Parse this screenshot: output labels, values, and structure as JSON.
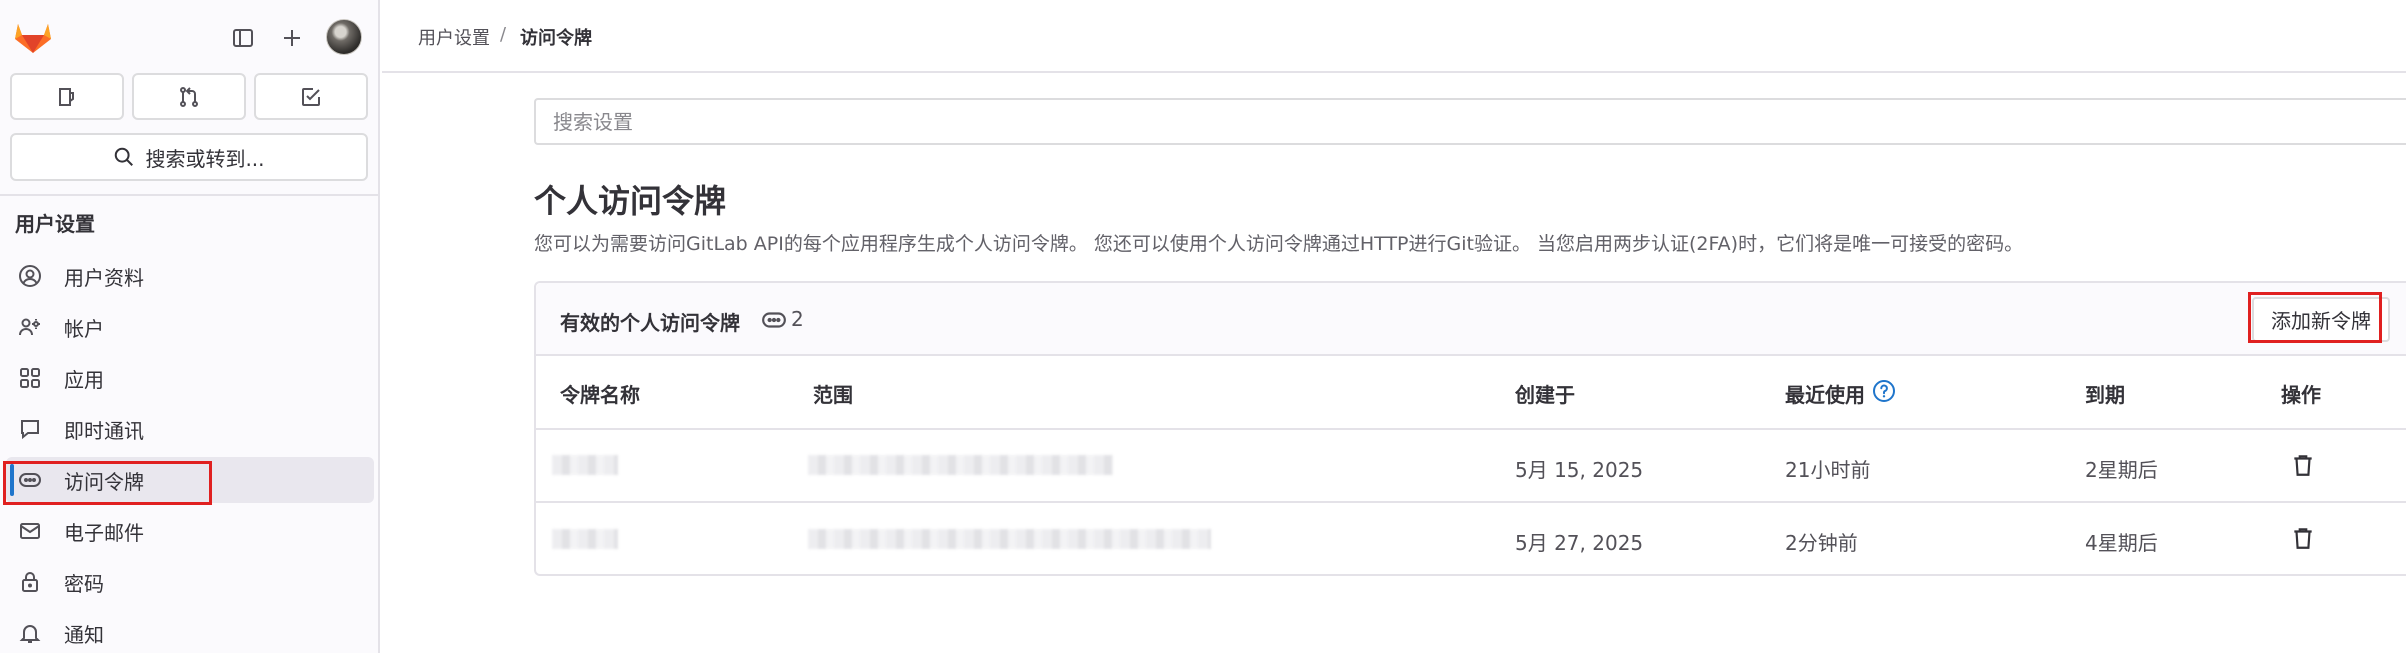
{
  "sidebar": {
    "quick_actions": [
      "issues",
      "merge-requests",
      "todos"
    ],
    "search_label": "搜索或转到...",
    "section_title": "用户设置",
    "items": [
      {
        "label": "用户资料",
        "icon": "profile-icon"
      },
      {
        "label": "帐户",
        "icon": "account-icon"
      },
      {
        "label": "应用",
        "icon": "applications-icon"
      },
      {
        "label": "即时通讯",
        "icon": "chat-icon"
      },
      {
        "label": "访问令牌",
        "icon": "token-icon",
        "active": true
      },
      {
        "label": "电子邮件",
        "icon": "mail-icon"
      },
      {
        "label": "密码",
        "icon": "lock-icon"
      },
      {
        "label": "通知",
        "icon": "bell-icon"
      }
    ]
  },
  "breadcrumb": {
    "parent": "用户设置",
    "separator": "/",
    "current": "访问令牌"
  },
  "main": {
    "search_placeholder": "搜索设置",
    "title": "个人访问令牌",
    "description": "您可以为需要访问GitLab API的每个应用程序生成个人访问令牌。 您还可以使用个人访问令牌通过HTTP进行Git验证。 当您启用两步认证(2FA)时，它们将是唯一可接受的密码。",
    "card": {
      "title": "有效的个人访问令牌",
      "count": "2",
      "add_button": "添加新令牌"
    },
    "table": {
      "headers": {
        "name": "令牌名称",
        "scope": "范围",
        "created": "创建于",
        "last_used": "最近使用",
        "expires": "到期",
        "actions": "操作"
      },
      "rows": [
        {
          "created": "5月 15, 2025",
          "last_used": "21小时前",
          "expires": "2星期后"
        },
        {
          "created": "5月 27, 2025",
          "last_used": "2分钟前",
          "expires": "4星期后"
        }
      ]
    }
  },
  "colors": {
    "accent": "#1f75cb",
    "highlight": "#e02020",
    "logo_orange": "#fc6d26",
    "logo_red": "#e24329",
    "logo_amber": "#fca326"
  }
}
